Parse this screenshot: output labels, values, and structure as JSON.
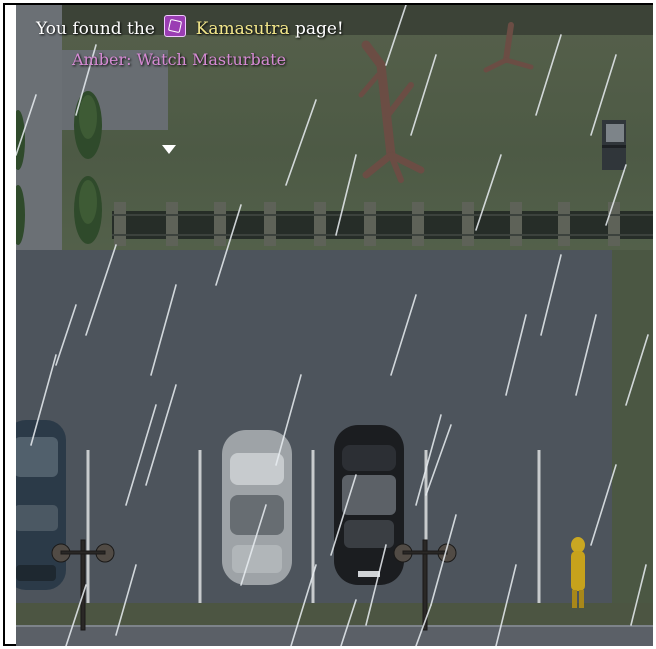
{
  "notification": {
    "prefix": "You found the",
    "item_name": "Kamasutra",
    "suffix": "page!",
    "book_icon": "book-icon",
    "item_color": "#f3e78b"
  },
  "quest": {
    "label": "Amber: Watch Masturbate",
    "color": "#d58ad3"
  },
  "scene": {
    "weather": "rain",
    "setting": "parking lot with fence and lawn",
    "cursor_icon": "down-triangle-icon"
  }
}
